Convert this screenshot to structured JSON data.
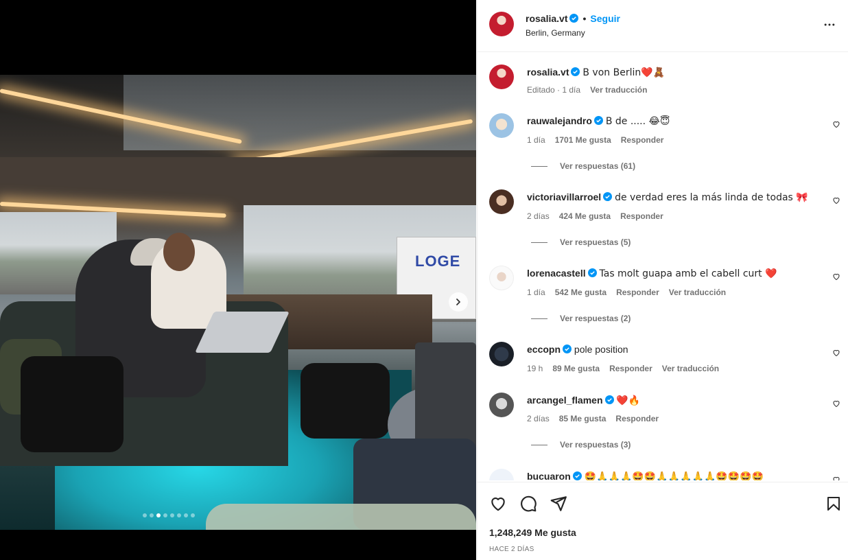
{
  "post": {
    "username": "rosalia.vt",
    "follow_label": "Seguir",
    "location": "Berlin, Germany",
    "caption": "B von Berlin❤️🧸",
    "caption_edited": "Editado",
    "caption_time": "1 día",
    "caption_translate": "Ver traducción",
    "likes": "1,248,249 Me gusta",
    "time_ago": "HACE 2 DÍAS",
    "carousel": {
      "total_slides": 8,
      "active_slide": 3
    },
    "truck_text": "LOGE"
  },
  "comments": [
    {
      "username": "rauwalejandro",
      "verified": true,
      "text": "B de ..... 😂😇",
      "time": "1 día",
      "likes": "1701 Me gusta",
      "reply": "Responder",
      "translate": "",
      "replies": "Ver respuestas (61)"
    },
    {
      "username": "victoriavillarroel",
      "verified": true,
      "text": "de verdad eres la más linda de todas 🎀",
      "time": "2 días",
      "likes": "424 Me gusta",
      "reply": "Responder",
      "translate": "",
      "replies": "Ver respuestas (5)"
    },
    {
      "username": "lorenacastell",
      "verified": true,
      "text": "Tas molt guapa amb el cabell curt ❤️",
      "time": "1 día",
      "likes": "542 Me gusta",
      "reply": "Responder",
      "translate": "Ver traducción",
      "replies": "Ver respuestas (2)"
    },
    {
      "username": "eccopn",
      "verified": true,
      "text": "pole position",
      "time": "19 h",
      "likes": "89 Me gusta",
      "reply": "Responder",
      "translate": "Ver traducción",
      "replies": ""
    },
    {
      "username": "arcangel_flamen",
      "verified": true,
      "text": "❤️🔥",
      "time": "2 días",
      "likes": "85 Me gusta",
      "reply": "Responder",
      "translate": "",
      "replies": "Ver respuestas (3)"
    },
    {
      "username": "bucuaron",
      "verified": true,
      "text": "🤩🙏🙏🙏🤩🤩🙏🙏🙏🙏🙏🤩🤩🤩🤩",
      "time": "",
      "likes": "",
      "reply": "",
      "translate": "",
      "replies": ""
    }
  ],
  "icons": {
    "verified": "verified-badge-icon",
    "more": "more-options-icon",
    "like": "heart-icon",
    "comment": "comment-icon",
    "share": "share-icon",
    "save": "bookmark-icon",
    "next": "chevron-right-icon"
  },
  "colors": {
    "accent": "#0095f6",
    "verified": "#0095f6",
    "meta": "#737373",
    "text": "#262626"
  }
}
